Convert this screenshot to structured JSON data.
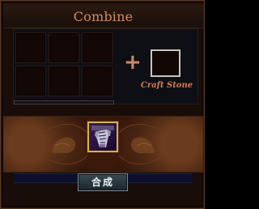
{
  "window": {
    "title": "Combine"
  },
  "crafting": {
    "grid_slots": [
      {
        "id": 1
      },
      {
        "id": 2
      },
      {
        "id": 3
      },
      {
        "id": 4
      },
      {
        "id": 5
      },
      {
        "id": 6
      }
    ],
    "plus_symbol": "+",
    "craft_stone_label": "Craft Stone",
    "progress": 0
  },
  "result": {
    "item_icon": "gauntlet-item-icon"
  },
  "actions": {
    "combine_label": "合成"
  },
  "colors": {
    "title": "#d98a58",
    "craft_label": "#d97a4a",
    "item_border": "#d9b14a",
    "button_text": "#eef3f5"
  }
}
